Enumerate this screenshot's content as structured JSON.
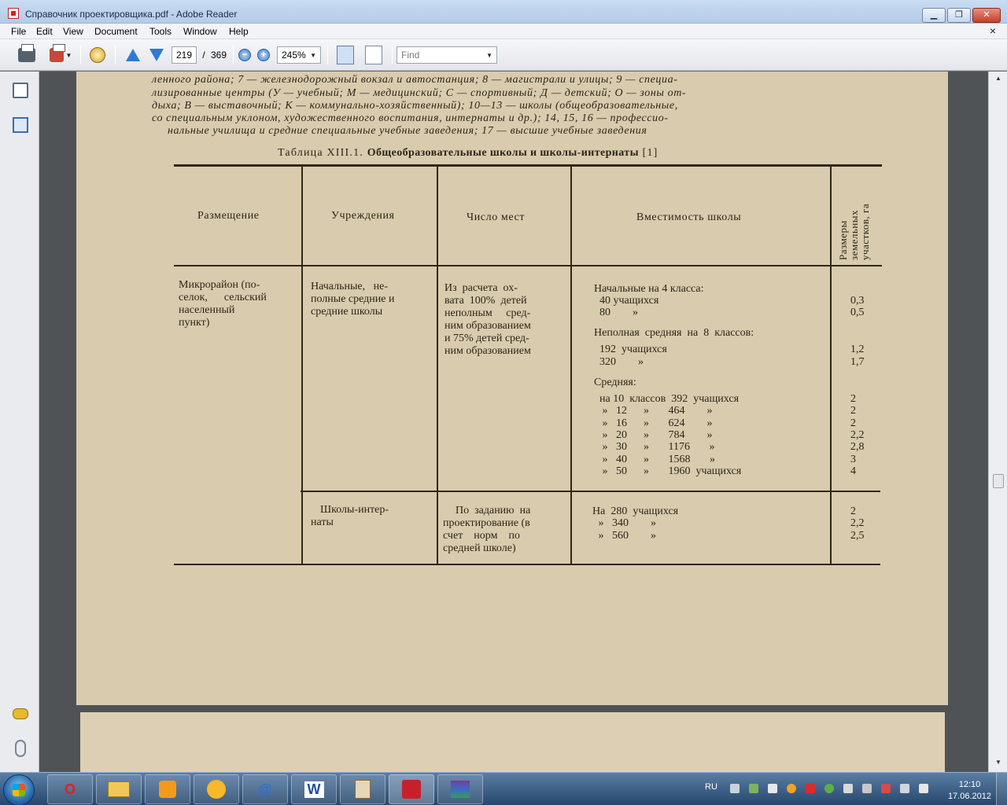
{
  "window": {
    "title": "Справочник проектировщика.pdf - Adobe Reader"
  },
  "menu": [
    "File",
    "Edit",
    "View",
    "Document",
    "Tools",
    "Window",
    "Help"
  ],
  "menu_close": "×",
  "toolbar": {
    "page_current": "219",
    "page_separator": "/",
    "page_total": "369",
    "zoom_out": "−",
    "zoom_in": "+",
    "zoom": "245%",
    "find_placeholder": "Find"
  },
  "document": {
    "caption_lines": [
      "ленного района; 7 — железнодорожный вокзал и автостанция; 8 — магистрали и улицы; 9 — специа-",
      "лизированные центры (У — учебный; М — медицинский; С — спортивный; Д — детский; О — зоны от-",
      "дыха; В — выставочный; К — коммунально-хозяйственный); 10—13 — школы (общеобразовательные,",
      "со специальным уклоном, художественного воспитания, интернаты и др.); 14, 15, 16 — профессио-",
      "нальные училища и средние специальные учебные заведения; 17 — высшие учебные заведения"
    ],
    "table_title_prefix": "Таблица XIII.1.",
    "table_title": "Общеобразовательные школы и школы-интернаты",
    "table_ref": "[1]",
    "headers": {
      "placement": "Размещение",
      "institutions": "Учреждения",
      "places": "Число мест",
      "capacity": "Вместимость школы",
      "plot_size": "Размеры земельных участков, га"
    },
    "placement_value": [
      "Микрорайон (по-",
      "селок,      сельский",
      "населенный",
      "пункт)"
    ],
    "group1": {
      "institution": [
        "Начальные,   не-",
        "полные средние и",
        "средние школы"
      ],
      "places": [
        "Из  расчета  ох-",
        "вата  100%  детей",
        "неполным     сред-",
        "ним образованием",
        "и 75% детей сред-",
        "ним образованием"
      ],
      "rows": [
        {
          "capacity": "Начальные на 4 класса:",
          "area": ""
        },
        {
          "capacity": "  40 учащихся",
          "area": "0,3"
        },
        {
          "capacity": "  80        »",
          "area": "0,5"
        },
        {
          "capacity": "Неполная  средняя  на  8  классов:",
          "area": ""
        },
        {
          "capacity": "  192  учащихся",
          "area": "1,2"
        },
        {
          "capacity": "  320        »",
          "area": "1,7"
        },
        {
          "capacity": "Средняя:",
          "area": ""
        },
        {
          "capacity": "  на 10  классов  392  учащихся",
          "area": "2"
        },
        {
          "capacity": "   »   12      »       464        »",
          "area": "2"
        },
        {
          "capacity": "   »   16      »       624        »",
          "area": "2"
        },
        {
          "capacity": "   »   20      »       784        »",
          "area": "2,2"
        },
        {
          "capacity": "   »   30      »       1176       »",
          "area": "2,8"
        },
        {
          "capacity": "   »   40      »       1568       »",
          "area": "3"
        },
        {
          "capacity": "   »   50      »       1960  учащихся",
          "area": "4"
        }
      ]
    },
    "group2": {
      "institution": [
        "Школы-интер-",
        "наты"
      ],
      "places": [
        "По  заданию  на",
        "проектирование (в",
        "счет    норм    по",
        "средней школе)"
      ],
      "rows": [
        {
          "capacity": "На  280  учащихся",
          "area": "2"
        },
        {
          "capacity": " »   340        »",
          "area": "2,2"
        },
        {
          "capacity": " »   560        »",
          "area": "2,5"
        }
      ]
    }
  },
  "taskbar": {
    "lang": "RU",
    "time": "12:10",
    "date": "17.06.2012",
    "word_label": "W",
    "opera_label": "O",
    "mail_label": "@"
  }
}
